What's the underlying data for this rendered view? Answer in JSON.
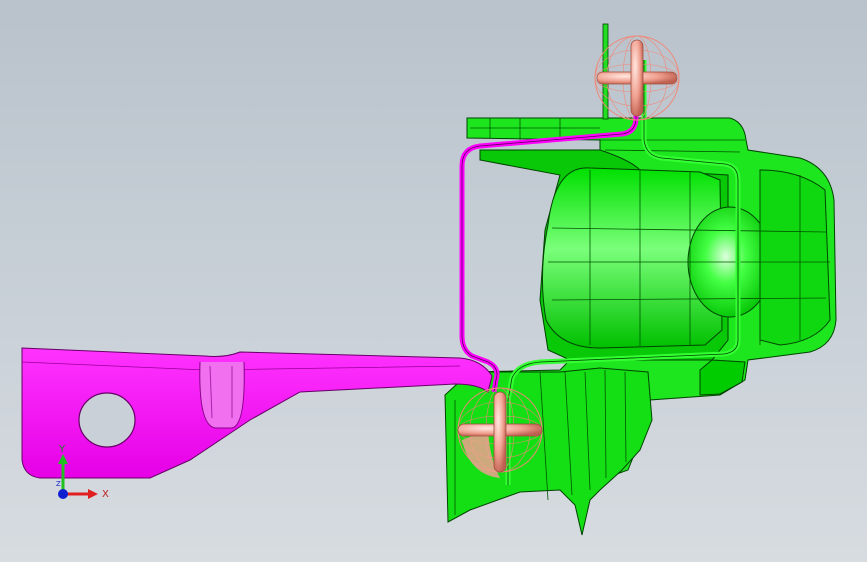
{
  "viewport": {
    "background": "#c4ccd4"
  },
  "parts": [
    {
      "name": "bracket-arm",
      "color": "#ff00ff"
    },
    {
      "name": "mounting-body",
      "color": "#00ff00"
    },
    {
      "name": "seal-sections",
      "color": "#00aa00"
    }
  ],
  "constraints": {
    "weld_marker_color": "#f0a090",
    "count": 2
  },
  "triad": {
    "x_label": "X",
    "y_label": "Y",
    "z_label": "Z",
    "x_color": "#e02020",
    "y_color": "#20c020",
    "z_color": "#1020d0"
  }
}
